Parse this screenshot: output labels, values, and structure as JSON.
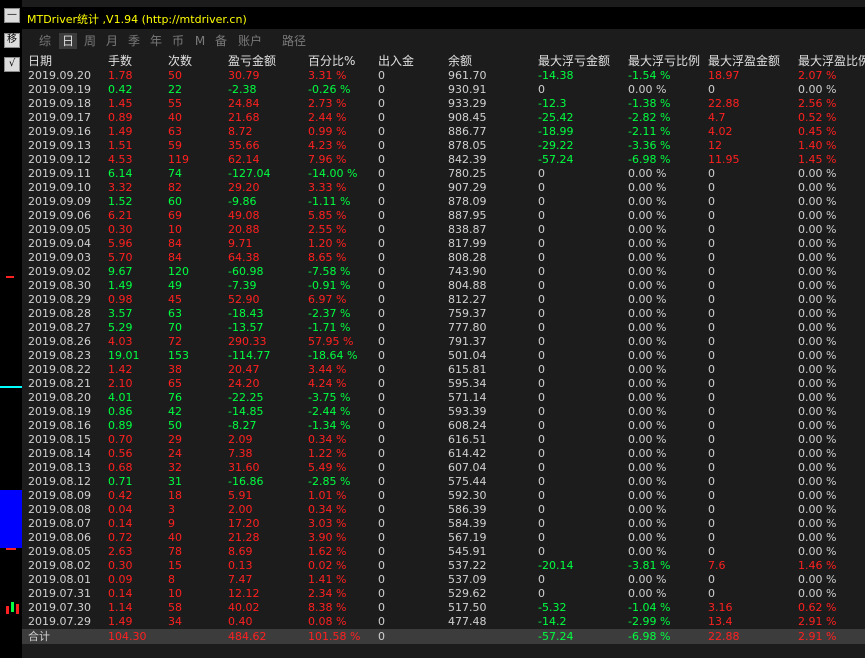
{
  "window": {
    "title": "MTDriver统计 ,V1.94 (http://mtdriver.cn)"
  },
  "left_panel": {
    "minimize_btn": "—",
    "move_btn": "移",
    "check_btn": "√"
  },
  "toolbar": {
    "items": [
      "综",
      "日",
      "周",
      "月",
      "季",
      "年",
      "币",
      "M",
      "备",
      "账户",
      "路径"
    ],
    "active": "日"
  },
  "colors": {
    "red": "#ff2020",
    "green": "#00ff40",
    "title": "#ffff00",
    "white": "#d0d0d0"
  },
  "table": {
    "headers": [
      "日期",
      "手数",
      "次数",
      "盈亏金额",
      "百分比%",
      "出入金",
      "余额",
      "最大浮亏金额",
      "最大浮亏比例",
      "最大浮盈金额",
      "最大浮盈比例"
    ],
    "rows": [
      [
        "2019.09.20",
        "1.78",
        "50",
        "30.79",
        "3.31 %",
        "0",
        "961.70",
        "-14.38",
        "-1.54 %",
        "18.97",
        "2.07 %"
      ],
      [
        "2019.09.19",
        "0.42",
        "22",
        "-2.38",
        "-0.26 %",
        "0",
        "930.91",
        "0",
        "0.00 %",
        "0",
        "0.00 %"
      ],
      [
        "2019.09.18",
        "1.45",
        "55",
        "24.84",
        "2.73 %",
        "0",
        "933.29",
        "-12.3",
        "-1.38 %",
        "22.88",
        "2.56 %"
      ],
      [
        "2019.09.17",
        "0.89",
        "40",
        "21.68",
        "2.44 %",
        "0",
        "908.45",
        "-25.42",
        "-2.82 %",
        "4.7",
        "0.52 %"
      ],
      [
        "2019.09.16",
        "1.49",
        "63",
        "8.72",
        "0.99 %",
        "0",
        "886.77",
        "-18.99",
        "-2.11 %",
        "4.02",
        "0.45 %"
      ],
      [
        "2019.09.13",
        "1.51",
        "59",
        "35.66",
        "4.23 %",
        "0",
        "878.05",
        "-29.22",
        "-3.36 %",
        "12",
        "1.40 %"
      ],
      [
        "2019.09.12",
        "4.53",
        "119",
        "62.14",
        "7.96 %",
        "0",
        "842.39",
        "-57.24",
        "-6.98 %",
        "11.95",
        "1.45 %"
      ],
      [
        "2019.09.11",
        "6.14",
        "74",
        "-127.04",
        "-14.00 %",
        "0",
        "780.25",
        "0",
        "0.00 %",
        "0",
        "0.00 %"
      ],
      [
        "2019.09.10",
        "3.32",
        "82",
        "29.20",
        "3.33 %",
        "0",
        "907.29",
        "0",
        "0.00 %",
        "0",
        "0.00 %"
      ],
      [
        "2019.09.09",
        "1.52",
        "60",
        "-9.86",
        "-1.11 %",
        "0",
        "878.09",
        "0",
        "0.00 %",
        "0",
        "0.00 %"
      ],
      [
        "2019.09.06",
        "6.21",
        "69",
        "49.08",
        "5.85 %",
        "0",
        "887.95",
        "0",
        "0.00 %",
        "0",
        "0.00 %"
      ],
      [
        "2019.09.05",
        "0.30",
        "10",
        "20.88",
        "2.55 %",
        "0",
        "838.87",
        "0",
        "0.00 %",
        "0",
        "0.00 %"
      ],
      [
        "2019.09.04",
        "5.96",
        "84",
        "9.71",
        "1.20 %",
        "0",
        "817.99",
        "0",
        "0.00 %",
        "0",
        "0.00 %"
      ],
      [
        "2019.09.03",
        "5.70",
        "84",
        "64.38",
        "8.65 %",
        "0",
        "808.28",
        "0",
        "0.00 %",
        "0",
        "0.00 %"
      ],
      [
        "2019.09.02",
        "9.67",
        "120",
        "-60.98",
        "-7.58 %",
        "0",
        "743.90",
        "0",
        "0.00 %",
        "0",
        "0.00 %"
      ],
      [
        "2019.08.30",
        "1.49",
        "49",
        "-7.39",
        "-0.91 %",
        "0",
        "804.88",
        "0",
        "0.00 %",
        "0",
        "0.00 %"
      ],
      [
        "2019.08.29",
        "0.98",
        "45",
        "52.90",
        "6.97 %",
        "0",
        "812.27",
        "0",
        "0.00 %",
        "0",
        "0.00 %"
      ],
      [
        "2019.08.28",
        "3.57",
        "63",
        "-18.43",
        "-2.37 %",
        "0",
        "759.37",
        "0",
        "0.00 %",
        "0",
        "0.00 %"
      ],
      [
        "2019.08.27",
        "5.29",
        "70",
        "-13.57",
        "-1.71 %",
        "0",
        "777.80",
        "0",
        "0.00 %",
        "0",
        "0.00 %"
      ],
      [
        "2019.08.26",
        "4.03",
        "72",
        "290.33",
        "57.95 %",
        "0",
        "791.37",
        "0",
        "0.00 %",
        "0",
        "0.00 %"
      ],
      [
        "2019.08.23",
        "19.01",
        "153",
        "-114.77",
        "-18.64 %",
        "0",
        "501.04",
        "0",
        "0.00 %",
        "0",
        "0.00 %"
      ],
      [
        "2019.08.22",
        "1.42",
        "38",
        "20.47",
        "3.44 %",
        "0",
        "615.81",
        "0",
        "0.00 %",
        "0",
        "0.00 %"
      ],
      [
        "2019.08.21",
        "2.10",
        "65",
        "24.20",
        "4.24 %",
        "0",
        "595.34",
        "0",
        "0.00 %",
        "0",
        "0.00 %"
      ],
      [
        "2019.08.20",
        "4.01",
        "76",
        "-22.25",
        "-3.75 %",
        "0",
        "571.14",
        "0",
        "0.00 %",
        "0",
        "0.00 %"
      ],
      [
        "2019.08.19",
        "0.86",
        "42",
        "-14.85",
        "-2.44 %",
        "0",
        "593.39",
        "0",
        "0.00 %",
        "0",
        "0.00 %"
      ],
      [
        "2019.08.16",
        "0.89",
        "50",
        "-8.27",
        "-1.34 %",
        "0",
        "608.24",
        "0",
        "0.00 %",
        "0",
        "0.00 %"
      ],
      [
        "2019.08.15",
        "0.70",
        "29",
        "2.09",
        "0.34 %",
        "0",
        "616.51",
        "0",
        "0.00 %",
        "0",
        "0.00 %"
      ],
      [
        "2019.08.14",
        "0.56",
        "24",
        "7.38",
        "1.22 %",
        "0",
        "614.42",
        "0",
        "0.00 %",
        "0",
        "0.00 %"
      ],
      [
        "2019.08.13",
        "0.68",
        "32",
        "31.60",
        "5.49 %",
        "0",
        "607.04",
        "0",
        "0.00 %",
        "0",
        "0.00 %"
      ],
      [
        "2019.08.12",
        "0.71",
        "31",
        "-16.86",
        "-2.85 %",
        "0",
        "575.44",
        "0",
        "0.00 %",
        "0",
        "0.00 %"
      ],
      [
        "2019.08.09",
        "0.42",
        "18",
        "5.91",
        "1.01 %",
        "0",
        "592.30",
        "0",
        "0.00 %",
        "0",
        "0.00 %"
      ],
      [
        "2019.08.08",
        "0.04",
        "3",
        "2.00",
        "0.34 %",
        "0",
        "586.39",
        "0",
        "0.00 %",
        "0",
        "0.00 %"
      ],
      [
        "2019.08.07",
        "0.14",
        "9",
        "17.20",
        "3.03 %",
        "0",
        "584.39",
        "0",
        "0.00 %",
        "0",
        "0.00 %"
      ],
      [
        "2019.08.06",
        "0.72",
        "40",
        "21.28",
        "3.90 %",
        "0",
        "567.19",
        "0",
        "0.00 %",
        "0",
        "0.00 %"
      ],
      [
        "2019.08.05",
        "2.63",
        "78",
        "8.69",
        "1.62 %",
        "0",
        "545.91",
        "0",
        "0.00 %",
        "0",
        "0.00 %"
      ],
      [
        "2019.08.02",
        "0.30",
        "15",
        "0.13",
        "0.02 %",
        "0",
        "537.22",
        "-20.14",
        "-3.81 %",
        "7.6",
        "1.46 %"
      ],
      [
        "2019.08.01",
        "0.09",
        "8",
        "7.47",
        "1.41 %",
        "0",
        "537.09",
        "0",
        "0.00 %",
        "0",
        "0.00 %"
      ],
      [
        "2019.07.31",
        "0.14",
        "10",
        "12.12",
        "2.34 %",
        "0",
        "529.62",
        "0",
        "0.00 %",
        "0",
        "0.00 %"
      ],
      [
        "2019.07.30",
        "1.14",
        "58",
        "40.02",
        "8.38 %",
        "0",
        "517.50",
        "-5.32",
        "-1.04 %",
        "3.16",
        "0.62 %"
      ],
      [
        "2019.07.29",
        "1.49",
        "34",
        "0.40",
        "0.08 %",
        "0",
        "477.48",
        "-14.2",
        "-2.99 %",
        "13.4",
        "2.91 %"
      ]
    ],
    "total": [
      "合计",
      "104.30",
      "",
      "484.62",
      "101.58 %",
      "0",
      "",
      "-57.24",
      "-6.98 %",
      "22.88",
      "2.91 %"
    ]
  }
}
